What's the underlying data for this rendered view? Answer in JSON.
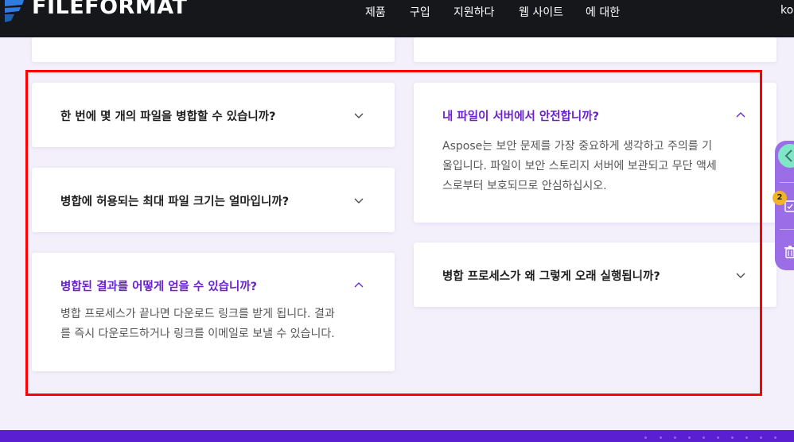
{
  "header": {
    "logo_text": "FILEFORMAT",
    "nav": [
      "제품",
      "구입",
      "지원하다",
      "웹 사이트",
      "에 대한"
    ],
    "lang": "ko"
  },
  "faq": {
    "left": [
      {
        "question": "한 번에 몇 개의 파일을 병합할 수 있습니까?",
        "expanded": false
      },
      {
        "question": "병합에 허용되는 최대 파일 크기는 얼마입니까?",
        "expanded": false
      },
      {
        "question": "병합된 결과를 어떻게 얻을 수 있습니까?",
        "expanded": true,
        "answer_lines": [
          "병합 프로세스가 끝나면 다운로드 링크를 받게 됩니다. 결과",
          "를 즉시 다운로드하거나 링크를 이메일로 보낼 수 있습니다."
        ]
      }
    ],
    "right": [
      {
        "question": "내 파일이 서버에서 안전합니까?",
        "expanded": true,
        "answer_lines": [
          "Aspose는 보안 문제를 가장 중요하게 생각하고 주의를 기",
          "울입니다. 파일이 보안 스토리지 서버에 보관되고 무단 액세",
          "스로부터 보호되므로 안심하십시오."
        ]
      },
      {
        "question": "병합 프로세스가 왜 그렇게 오래 실행됩니까?",
        "expanded": false
      }
    ]
  },
  "side_widget": {
    "badge_count": "2"
  },
  "colors": {
    "accent_purple": "#6a1fd0",
    "header_bg": "#15171b",
    "highlight": "#ff0000",
    "footer": "#5a1fd1"
  }
}
